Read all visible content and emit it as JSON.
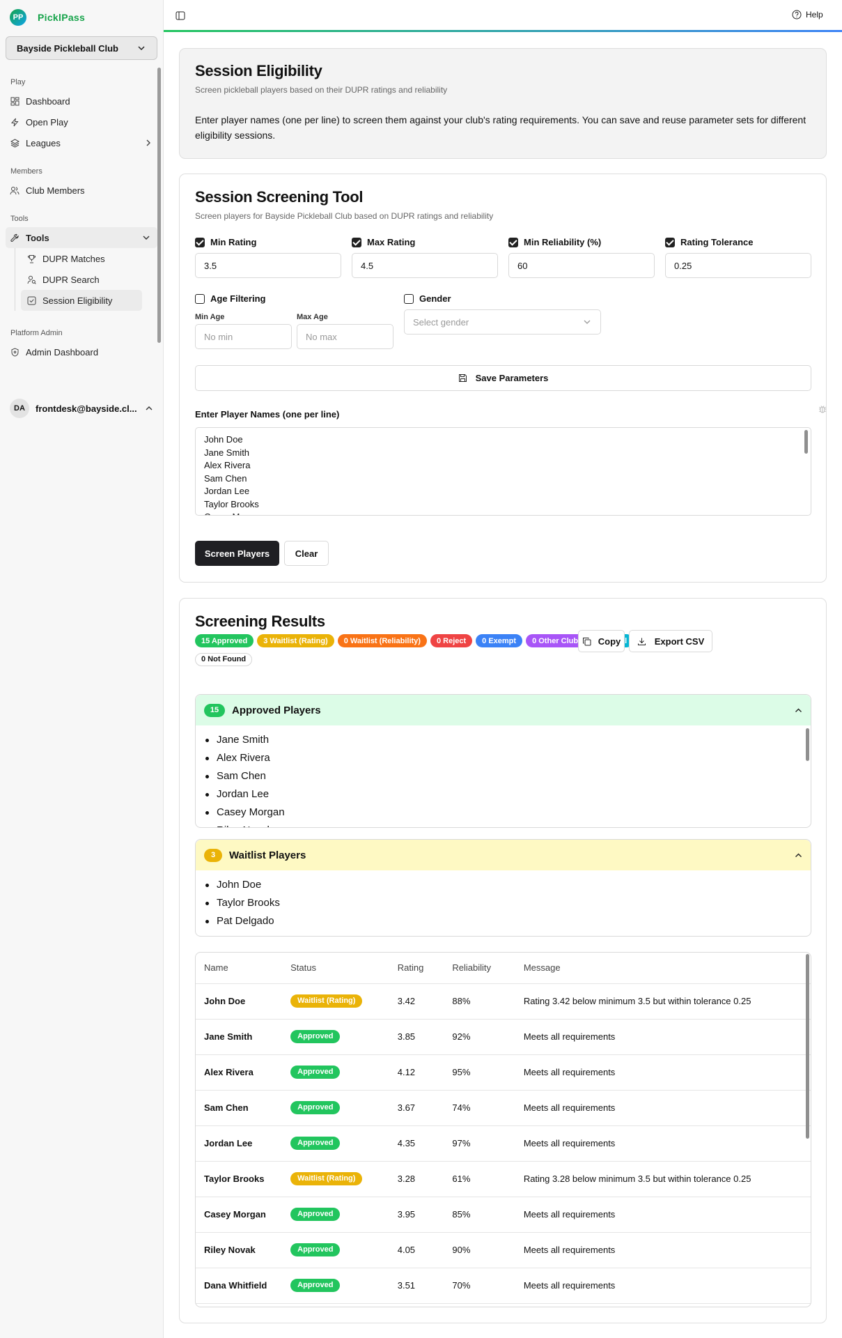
{
  "app": {
    "logo_initials": "PP",
    "name": "PicklPass"
  },
  "sidebar": {
    "club_select": "Bayside Pickleball Club",
    "sections": {
      "play": "Play",
      "members": "Members",
      "tools": "Tools",
      "platform_admin": "Platform Admin"
    },
    "items": {
      "dashboard": "Dashboard",
      "open_play": "Open Play",
      "leagues": "Leagues",
      "club_members": "Club Members",
      "tools": "Tools",
      "dupr_matches": "DUPR Matches",
      "dupr_search": "DUPR Search",
      "session_eligibility": "Session Eligibility",
      "admin_dashboard": "Admin Dashboard"
    },
    "user": {
      "initials": "DA",
      "email": "frontdesk@bayside.cl..."
    }
  },
  "topbar": {
    "help": "Help"
  },
  "intro": {
    "title": "Session Eligibility",
    "subtitle": "Screen pickleball players based on their DUPR ratings and reliability",
    "body": "Enter player names (one per line) to screen them against your club's rating requirements. You can save and reuse parameter sets for different eligibility sessions."
  },
  "tool": {
    "title": "Session Screening Tool",
    "subtitle": "Screen players for Bayside Pickleball Club based on DUPR ratings and reliability",
    "min_rating": {
      "label": "Min Rating",
      "value": "3.5",
      "checked": true
    },
    "max_rating": {
      "label": "Max Rating",
      "value": "4.5",
      "checked": true
    },
    "min_reliability": {
      "label": "Min Reliability (%)",
      "value": "60",
      "checked": true
    },
    "tolerance": {
      "label": "Rating Tolerance",
      "value": "0.25",
      "checked": true
    },
    "age": {
      "label": "Age Filtering",
      "min_label": "Min Age",
      "max_label": "Max Age",
      "min_placeholder": "No min",
      "max_placeholder": "No max",
      "checked": false
    },
    "gender": {
      "label": "Gender",
      "placeholder": "Select gender",
      "checked": false
    },
    "save_button": "Save Parameters",
    "names_label": "Enter Player Names (one per line)",
    "names": [
      "John Doe",
      "Jane Smith",
      "Alex Rivera",
      "Sam Chen",
      "Jordan Lee",
      "Taylor Brooks",
      "Casey Morgan"
    ],
    "screen_button": "Screen Players",
    "clear_button": "Clear"
  },
  "results": {
    "title": "Screening Results",
    "badges": [
      {
        "label": "15 Approved",
        "color": "#22c55e"
      },
      {
        "label": "3 Waitlist (Rating)",
        "color": "#eab308"
      },
      {
        "label": "0 Waitlist (Reliability)",
        "color": "#f97316"
      },
      {
        "label": "0 Reject",
        "color": "#ef4444"
      },
      {
        "label": "0 Exempt",
        "color": "#3b82f6"
      },
      {
        "label": "0 Other Club",
        "color": "#a855f7"
      },
      {
        "label": "0 Manual",
        "color": "#06b6d4"
      }
    ],
    "not_found": "0 Not Found",
    "copy_button": "Copy",
    "export_button": "Export CSV",
    "approved": {
      "count": "15",
      "title": "Approved Players",
      "players": [
        "Jane Smith",
        "Alex Rivera",
        "Sam Chen",
        "Jordan Lee",
        "Casey Morgan",
        "Riley Novak"
      ]
    },
    "waitlist": {
      "count": "3",
      "title": "Waitlist Players",
      "players": [
        "John Doe",
        "Taylor Brooks",
        "Pat Delgado"
      ]
    },
    "table": {
      "headers": [
        "Name",
        "Status",
        "Rating",
        "Reliability",
        "Message"
      ],
      "rows": [
        {
          "name": "John Doe",
          "status": "Waitlist (Rating)",
          "rating": "3.42",
          "reliability": "88%",
          "message": "Rating 3.42 below minimum 3.5 but within tolerance 0.25"
        },
        {
          "name": "Jane Smith",
          "status": "Approved",
          "rating": "3.85",
          "reliability": "92%",
          "message": "Meets all requirements"
        },
        {
          "name": "Alex Rivera",
          "status": "Approved",
          "rating": "4.12",
          "reliability": "95%",
          "message": "Meets all requirements"
        },
        {
          "name": "Sam Chen",
          "status": "Approved",
          "rating": "3.67",
          "reliability": "74%",
          "message": "Meets all requirements"
        },
        {
          "name": "Jordan Lee",
          "status": "Approved",
          "rating": "4.35",
          "reliability": "97%",
          "message": "Meets all requirements"
        },
        {
          "name": "Taylor Brooks",
          "status": "Waitlist (Rating)",
          "rating": "3.28",
          "reliability": "61%",
          "message": "Rating 3.28 below minimum 3.5 but within tolerance 0.25"
        },
        {
          "name": "Casey Morgan",
          "status": "Approved",
          "rating": "3.95",
          "reliability": "85%",
          "message": "Meets all requirements"
        },
        {
          "name": "Riley Novak",
          "status": "Approved",
          "rating": "4.05",
          "reliability": "90%",
          "message": "Meets all requirements"
        },
        {
          "name": "Dana Whitfield",
          "status": "Approved",
          "rating": "3.51",
          "reliability": "70%",
          "message": "Meets all requirements"
        }
      ]
    }
  },
  "colors": {
    "approved": "#22c55e",
    "waitlist": "#eab308",
    "brand": "#16a34a",
    "approved_bg": "#dcfce7",
    "waitlist_bg": "#fef9c3"
  }
}
